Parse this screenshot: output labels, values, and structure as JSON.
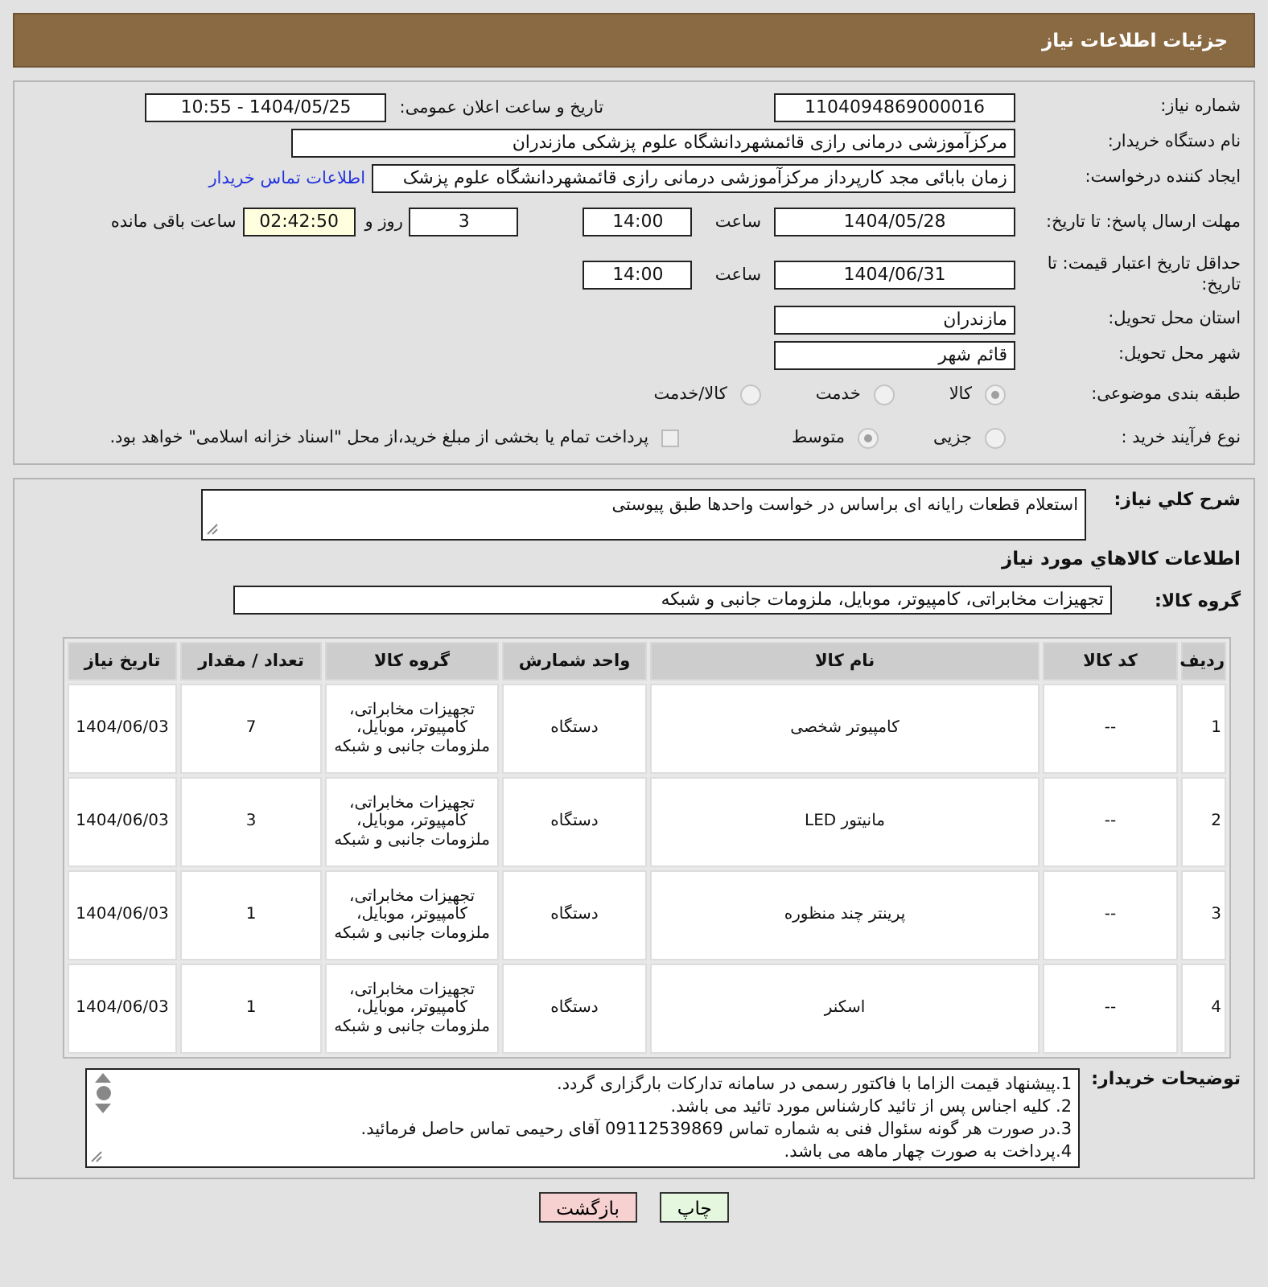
{
  "header": {
    "title": "جزئیات اطلاعات نیاز"
  },
  "need_number": {
    "label": "شماره نیاز:",
    "value": "1104094869000016"
  },
  "announce": {
    "label": "تاریخ و ساعت اعلان عمومی:",
    "value": "1404/05/25 - 10:55"
  },
  "buyer_org": {
    "label": "نام دستگاه خریدار:",
    "value": "مرکزآموزشی درمانی رازی قائمشهردانشگاه علوم پزشکی مازندران"
  },
  "creator": {
    "label": "ایجاد کننده درخواست:",
    "value": "زمان بابائی مجد کارپرداز مرکزآموزشی درمانی رازی قائمشهردانشگاه علوم پزشک",
    "link": "اطلاعات تماس خریدار"
  },
  "deadline": {
    "label": "مهلت ارسال پاسخ: تا تاریخ:",
    "date": "1404/05/28",
    "time_label": "ساعت",
    "time": "14:00",
    "days": "3",
    "days_label": "روز و",
    "remaining": "02:42:50",
    "remaining_label": "ساعت باقی مانده"
  },
  "validity": {
    "label": "حداقل تاریخ اعتبار قیمت: تا تاریخ:",
    "date": "1404/06/31",
    "time_label": "ساعت",
    "time": "14:00"
  },
  "province": {
    "label": "استان محل تحویل:",
    "value": "مازندران"
  },
  "city": {
    "label": "شهر محل تحویل:",
    "value": "قائم شهر"
  },
  "category": {
    "label": "طبقه بندی موضوعی:",
    "options": [
      {
        "label": "کالا",
        "selected": true
      },
      {
        "label": "خدمت",
        "selected": false
      },
      {
        "label": "کالا/خدمت",
        "selected": false
      }
    ]
  },
  "purchase_type": {
    "label": "نوع فرآیند خرید :",
    "options": [
      {
        "label": "جزیی",
        "selected": false
      },
      {
        "label": "متوسط",
        "selected": true
      }
    ],
    "payment": {
      "checked": false,
      "text": "پرداخت تمام یا بخشی از مبلغ خرید،از محل \"اسناد خزانه اسلامی\" خواهد بود."
    }
  },
  "description": {
    "label": "شرح كلي نياز:",
    "value": "استعلام قطعات رایانه ای براساس در خواست واحدها طبق پیوستی"
  },
  "goods_heading": "اطلاعات كالاهاي مورد نياز",
  "goods_group": {
    "label": "گروه کالا:",
    "value": "تجهیزات مخابراتی، کامپیوتر، موبایل، ملزومات جانبی و شبکه"
  },
  "table": {
    "columns": [
      "ردیف",
      "کد کالا",
      "نام کالا",
      "واحد شمارش",
      "گروه کالا",
      "تعداد / مقدار",
      "تاریخ نیاز"
    ],
    "rows": [
      {
        "cells": [
          "1",
          "--",
          "کامپیوتر شخصی",
          "دستگاه",
          "تجهیزات مخابراتی، کامپیوتر، موبایل، ملزومات جانبی و شبکه",
          "7",
          "1404/06/03"
        ]
      },
      {
        "cells": [
          "2",
          "--",
          "مانیتور LED",
          "دستگاه",
          "تجهیزات مخابراتی، کامپیوتر، موبایل، ملزومات جانبی و شبکه",
          "3",
          "1404/06/03"
        ]
      },
      {
        "cells": [
          "3",
          "--",
          "پرینتر چند منظوره",
          "دستگاه",
          "تجهیزات مخابراتی، کامپیوتر، موبایل، ملزومات جانبی و شبکه",
          "1",
          "1404/06/03"
        ]
      },
      {
        "cells": [
          "4",
          "--",
          "اسکنر",
          "دستگاه",
          "تجهیزات مخابراتی، کامپیوتر، موبایل، ملزومات جانبی و شبکه",
          "1",
          "1404/06/03"
        ]
      }
    ]
  },
  "notes": {
    "label": "توضیحات خریدار:",
    "lines": [
      "1.پیشنهاد قیمت الزاما با  فاکتور رسمی در سامانه تدارکات بارگزاری گردد.",
      "2. کلیه اجناس پس از تائید کارشناس مورد تائید می باشد.",
      "3.در صورت هر گونه سئوال فنی به شماره تماس 09112539869 آقای  رحیمی تماس حاصل فرمائید.",
      "4.پرداخت به صورت چهار ماهه می باشد."
    ]
  },
  "buttons": [
    {
      "label": "چاپ",
      "kind": "print"
    },
    {
      "label": "بازگشت",
      "kind": "back"
    }
  ]
}
